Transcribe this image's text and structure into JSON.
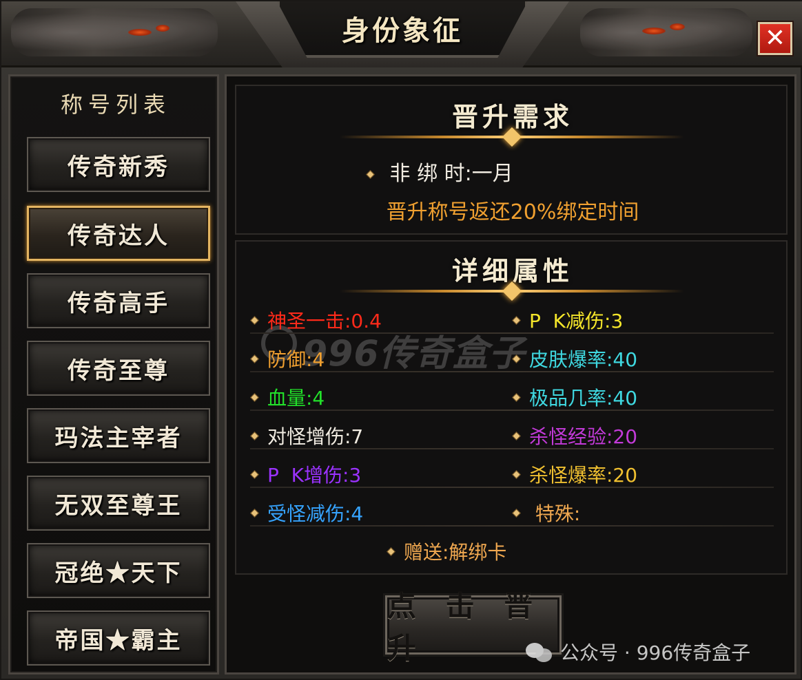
{
  "window": {
    "title": "身份象征",
    "close_glyph": "✕"
  },
  "title_list": {
    "heading": "称号列表",
    "items": [
      {
        "label": "传奇新秀",
        "selected": false
      },
      {
        "label": "传奇达人",
        "selected": true
      },
      {
        "label": "传奇高手",
        "selected": false
      },
      {
        "label": "传奇至尊",
        "selected": false
      },
      {
        "label": "玛法主宰者",
        "selected": false
      },
      {
        "label": "无双至尊王",
        "selected": false
      },
      {
        "label": "冠绝★天下",
        "selected": false
      },
      {
        "label": "帝国★霸主",
        "selected": false
      }
    ]
  },
  "requirements": {
    "heading": "晋升需求",
    "line": "非 绑 时:一月",
    "note": "晋升称号返还20%绑定时间"
  },
  "attributes": {
    "heading": "详细属性",
    "left": [
      {
        "label": "神圣一击:0.4",
        "color": "#ff2a1a"
      },
      {
        "label": "防御:4",
        "color": "#f0a030"
      },
      {
        "label": "血量:4",
        "color": "#22e02a"
      },
      {
        "label": "对怪增伤:7",
        "color": "#f1ece2"
      },
      {
        "label": "P  K增伤:3",
        "color": "#9b32ff"
      },
      {
        "label": "受怪减伤:4",
        "color": "#36a4ff"
      }
    ],
    "right": [
      {
        "label": "P  K减伤:3",
        "color": "#f5e62a"
      },
      {
        "label": "皮肤爆率:40",
        "color": "#3fd8e0"
      },
      {
        "label": "极品几率:40",
        "color": "#3fd8e0"
      },
      {
        "label": "杀怪经验:20",
        "color": "#c23ad8"
      },
      {
        "label": "杀怪爆率:20",
        "color": "#f0c030"
      },
      {
        "label": " 特殊:",
        "color": "#f0a850"
      }
    ],
    "gift": "赠送:解绑卡"
  },
  "promote_button": "点 击 晋 升",
  "watermark": "996传奇盒子",
  "footer_watermark": "公众号 · 996传奇盒子"
}
